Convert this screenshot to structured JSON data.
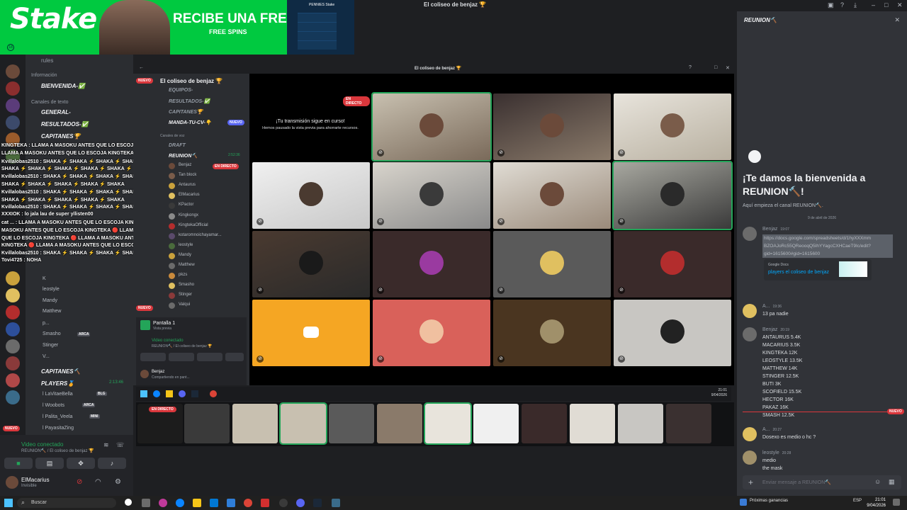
{
  "window": {
    "title": "El coliseo de benjaz 🏆"
  },
  "banner": {
    "brand": "Stake",
    "headline": "RECIBE UNA FREEBET",
    "subline": "FREE SPINS",
    "panel_label": "PENNIES Stake",
    "age_badge": "18"
  },
  "outer_channels": {
    "rules": "rules",
    "cat_info": "Información",
    "bienvenida": "BIENVENIDA-✅",
    "cat_text": "Canales de texto",
    "general": "GENERAL-",
    "resultados": "RESULTADOS-✅",
    "capitanes": "CAPITANES🏆",
    "capitanes_voice": "CAPITANES🔨",
    "players": "PLAYERS🏅",
    "players_time": "2:13:46",
    "users": [
      "K",
      "leostyle",
      "Mandy",
      "Matthew",
      "p...",
      "Smasho",
      "Stinger",
      "V..."
    ],
    "players_users": [
      "l LaVitaeBella",
      "l Woobots",
      "l Palita_Veela",
      "l PayasitaZing"
    ],
    "tags": {
      "blg": "BLG",
      "arca": "ARCA",
      "mini": "MINI"
    }
  },
  "overlay_chat": [
    "KINGTEKA : LLAMA A MASOKU ANTES QUE LO ESCOJA KINGTEKA",
    "LLAMA A MASOKU ANTES QUE LO ESCOJA KINGTEKA",
    "Kvillalobas2510 : SHAKA ⚡ SHAKA ⚡ SHAKA ⚡ SHAKA ⚡",
    "SHAKA ⚡ SHAKA ⚡ SHAKA ⚡ SHAKA ⚡ SHAKA ⚡",
    "Kvillalobas2510 : SHAKA ⚡ SHAKA ⚡ SHAKA ⚡ SHAKA",
    "SHAKA ⚡ SHAKA ⚡ SHAKA ⚡ SHAKA ⚡ SHAKA",
    "Kvillalobas2510 : SHAKA ⚡ SHAKA ⚡ SHAKA ⚡ SHAKA",
    "SHAKA ⚡ SHAKA ⚡ SHAKA ⚡ SHAKA ⚡ SHAKA",
    "Kvillalobas2510 : SHAKA ⚡ SHAKA ⚡ SHAKA ⚡ SHAKA",
    "XXXIOK : lo jala lau de super yllisten00",
    "cat ... : LLAMA A MASOKU ANTES QUE LO ESCOJA KINGTEKA 🔴 LLAMA A",
    "MASOKU ANTES QUE LO ESCOJA KINGTEKA 🔴 LLAMA A MASOKU ANTES",
    "QUE LO ESCOJA KINGTEKA 🔴 LLAMA A MASOKU ANTES QUE LO ESCOJA",
    "KINGTEKA 🔴 LLAMA A MASOKU ANTES QUE LO ESCOJA KINGTEKA",
    "Kvillalobas2510 : SHAKA ⚡ SHAKA ⚡ SHAKA ⚡ SHAKA ⚡ SHAKA",
    "Tovi4725 : NOHA"
  ],
  "inner_channels": {
    "server": "El coliseo de benjaz 🏆",
    "equipos": "EQUIPOS-",
    "resultados": "RESULTADOS-✅",
    "capitanes": "CAPITANES🏆",
    "manda": "MANDA-TU-CV-👇",
    "draft": "DRAFT",
    "cat_voice": "Canales de voz",
    "reunion": "REUNION🔨",
    "reunion_time": "2:52:36",
    "users": [
      "Benjaz",
      "Tan block",
      "Antaurus",
      "ElMacarius",
      "KPactor",
      "Kingkongx",
      "KingtekaOfficial",
      "kotaromnoichayamar...",
      "leostyle",
      "Mandy",
      "Matthew",
      "pkzs",
      "Smasho",
      "Stinger",
      "Valqui"
    ],
    "live_label": "EN DIRECTO",
    "nana_tag": "NANA",
    "arca_tag": "ARCA",
    "nuevo_badge": "NUEVO",
    "screen_label": "Pantalla 1",
    "screen_sub": "Vista previa",
    "video_status": "Video conectado",
    "video_channel": "REUNION🔨 / El coliseo de benjaz 🏆",
    "me_name": "Benjaz",
    "me_status": "Compartiendo en pant..."
  },
  "video_grid": {
    "live_label": "EN DIRECTO",
    "stream_title": "¡Tu transmisión sigue en curso!",
    "stream_sub": "Hemos pausado la vista previa para ahorrarte recursos."
  },
  "inner_taskbar": {
    "time": "21:01",
    "date": "9/04/2026"
  },
  "strip": {
    "live_label": "EN DIRECTO"
  },
  "user_panel": {
    "video_status": "Video conectado",
    "channel": "REUNION🔨 / El coliseo de benjaz 🏆",
    "name": "ElMacarius",
    "status": "Invisible"
  },
  "chat": {
    "channel": "REUNION🔨",
    "welcome": "¡Te damos la bienvenida a REUNION🔨!",
    "start": "Aquí empieza el canal REUNION🔨.",
    "date_divider": "9 de abril de 2026",
    "messages": [
      {
        "author": "Benjaz",
        "time": "19:07",
        "lines": [
          "https://docs.google.com/spreadsheets/d/1hyXXXmm",
          "BZOAJoRc55QReooqQ5IhYYagcCXHCaeT9Ic/edit?",
          "gid=1615600#gid=1615600"
        ]
      },
      {
        "author": "A...",
        "time": "19:36",
        "lines": [
          "13 pa nadie"
        ]
      },
      {
        "author": "Benjaz",
        "time": "20:19",
        "lines": [
          "ANTAURUS 5.4K",
          "MACARIUS 3.5K",
          "KINGTEKA 12K",
          "LEOSTYLE 13.5K",
          "MATTHEW 14K",
          "STINGER 12.5K",
          "BUTI 3K",
          "SCOFIELD 15.5K",
          "HECTOR 16K",
          "PAKAZ 16K",
          "SMASH 12.5K"
        ]
      },
      {
        "author": "A...",
        "time": "20:27",
        "lines": [
          "Dosexo es medio o hc ?"
        ]
      },
      {
        "author": "leostyle",
        "time": "20:28",
        "lines": [
          "medio",
          "the mask"
        ]
      }
    ],
    "embed_provider": "Google Docs",
    "embed_title": "players el coliseo de benjaz",
    "new_badge": "NUEVO",
    "input_placeholder": "Enviar mensaje a REUNION🔨"
  },
  "taskbar": {
    "search_placeholder": "Buscar",
    "news": "Próximas ganancias",
    "lang": "ESP",
    "time": "21:01",
    "date": "9/04/2026"
  },
  "colors": {
    "accent": "#5865f2",
    "green": "#23a559",
    "red": "#da373c",
    "stake": "#00c940"
  }
}
